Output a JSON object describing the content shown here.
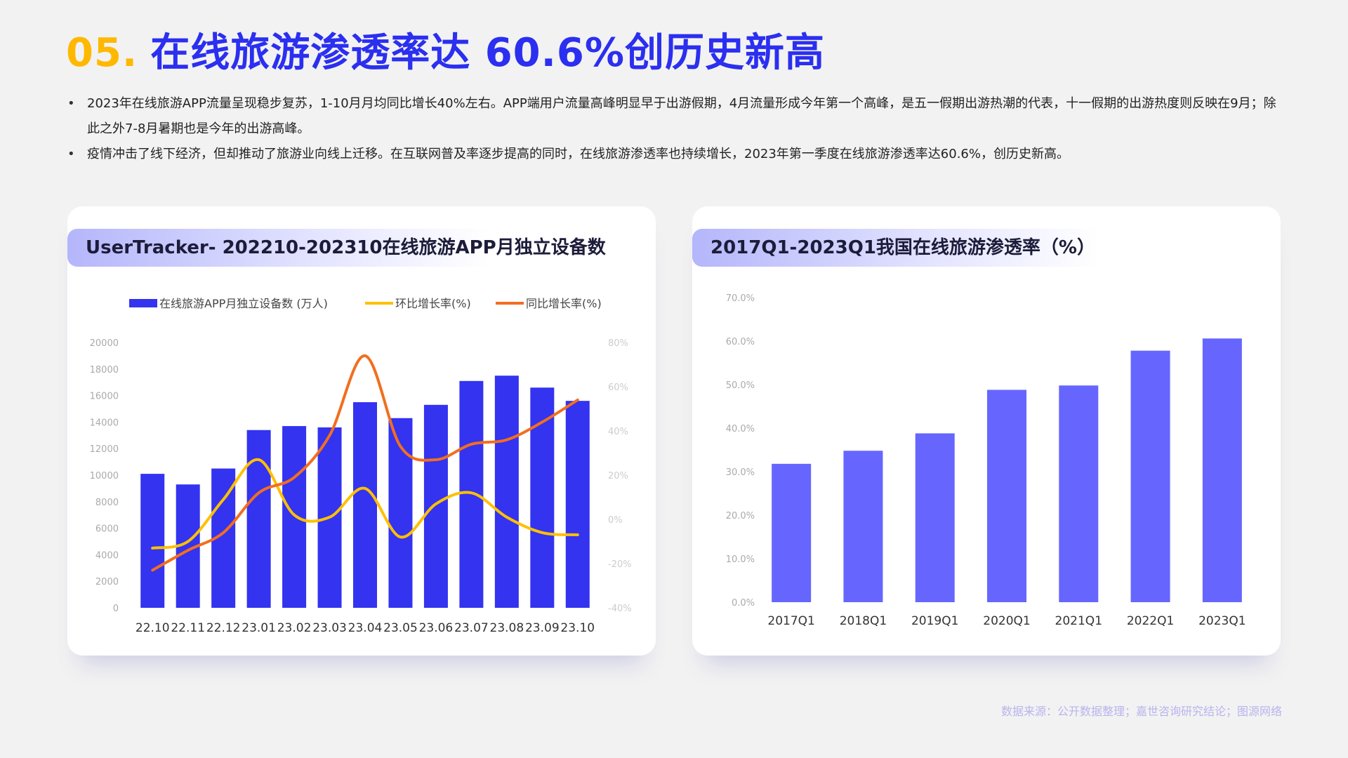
{
  "title": {
    "number": "05.",
    "text": "在线旅游渗透率达 60.6%创历史新高"
  },
  "bullets": [
    "2023年在线旅游APP流量呈现稳步复苏，1-10月月均同比增长40%左右。APP端用户流量高峰明显早于出游假期，4月流量形成今年第一个高峰，是五一假期出游热潮的代表，十一假期的出游热度则反映在9月；除此之外7-8月暑期也是今年的出游高峰。",
    "疫情冲击了线下经济，但却推动了旅游业向线上迁移。在互联网普及率逐步提高的同时，在线旅游渗透率也持续增长，2023年第一季度在线旅游渗透率达60.6%，创历史新高。"
  ],
  "source": "数据来源：公开数据整理；嘉世咨询研究结论；图源网络",
  "colors": {
    "bar": "#3333f0",
    "mom": "#ffc000",
    "yoy": "#f26e1e",
    "bar2": "#6666ff"
  },
  "chart_data": [
    {
      "type": "bar",
      "title": "UserTracker- 202210-202310在线旅游APP月独立设备数",
      "categories": [
        "22.10",
        "22.11",
        "22.12",
        "23.01",
        "23.02",
        "23.03",
        "23.04",
        "23.05",
        "23.06",
        "23.07",
        "23.08",
        "23.09",
        "23.10"
      ],
      "y_ticks": [
        "0",
        "2000",
        "4000",
        "6000",
        "8000",
        "10000",
        "12000",
        "14000",
        "16000",
        "18000",
        "20000"
      ],
      "y2_ticks": [
        "-40%",
        "-20%",
        "0%",
        "20%",
        "40%",
        "60%",
        "80%"
      ],
      "ylim": [
        0,
        20000
      ],
      "y2lim": [
        -40,
        80
      ],
      "legend_position": "top",
      "grid": false,
      "series": [
        {
          "name": "在线旅游APP月独立设备数 (万人)",
          "type": "bar",
          "axis": "left",
          "values": [
            10100,
            9300,
            10500,
            13400,
            13700,
            13600,
            15500,
            14300,
            15300,
            17100,
            17500,
            16600,
            15600
          ]
        },
        {
          "name": "环比增长率(%)",
          "type": "line",
          "axis": "right",
          "values": [
            -13,
            -10,
            9,
            27,
            2,
            1,
            14,
            -8,
            7,
            12,
            1,
            -6,
            -7
          ]
        },
        {
          "name": "同比增长率(%)",
          "type": "line",
          "axis": "right",
          "values": [
            -23,
            -14,
            -6,
            12,
            19,
            38,
            74,
            33,
            27,
            34,
            36,
            44,
            54
          ]
        }
      ]
    },
    {
      "type": "bar",
      "title": "2017Q1-2023Q1我国在线旅游渗透率（%）",
      "categories": [
        "2017Q1",
        "2018Q1",
        "2019Q1",
        "2020Q1",
        "2021Q1",
        "2022Q1",
        "2023Q1"
      ],
      "y_ticks": [
        "0.0%",
        "10.0%",
        "20.0%",
        "30.0%",
        "40.0%",
        "50.0%",
        "60.0%",
        "70.0%"
      ],
      "ylim": [
        0,
        70
      ],
      "grid": false,
      "values": [
        31.8,
        34.8,
        38.8,
        48.8,
        49.8,
        57.8,
        60.6
      ]
    }
  ]
}
